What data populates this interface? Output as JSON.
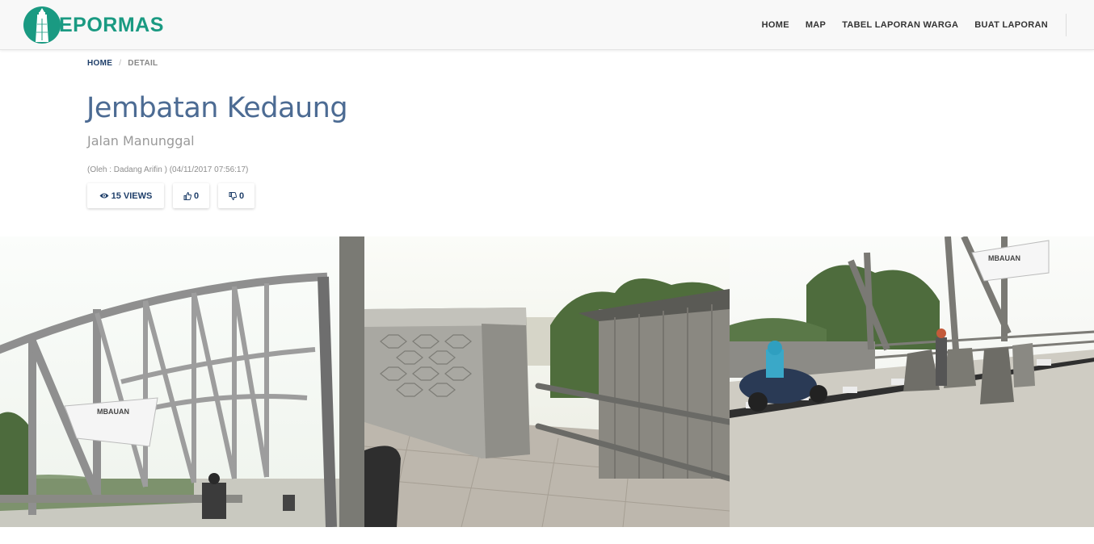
{
  "app": {
    "logo_text": "EPORMAS",
    "logo_icon": "tower-logo-icon"
  },
  "nav": {
    "items": [
      {
        "label": "HOME"
      },
      {
        "label": "MAP"
      },
      {
        "label": "TABEL LAPORAN WARGA"
      },
      {
        "label": "BUAT LAPORAN"
      }
    ]
  },
  "breadcrumb": {
    "home": "HOME",
    "separator": "/",
    "current": "DETAIL"
  },
  "report": {
    "title": "Jembatan Kedaung",
    "location": "Jalan Manunggal",
    "meta": "(Oleh : Dadang Arifin ) (04/11/2017 07:56:17)",
    "views": "15 VIEWS",
    "likes": "0",
    "dislikes": "0"
  },
  "icons": {
    "views": "eye-icon",
    "like": "thumbs-up-icon",
    "dislike": "thumbs-down-icon"
  },
  "colors": {
    "brand": "#1a9a82",
    "title": "#4c6b93",
    "navy": "#1f3f6a"
  },
  "photos": [
    {
      "name": "bridge-truss-photo",
      "sign_text": "MBAUAN"
    },
    {
      "name": "bridge-railing-photo",
      "sign_text": ""
    },
    {
      "name": "bridge-road-photo",
      "sign_text": "MBAUAN"
    }
  ]
}
